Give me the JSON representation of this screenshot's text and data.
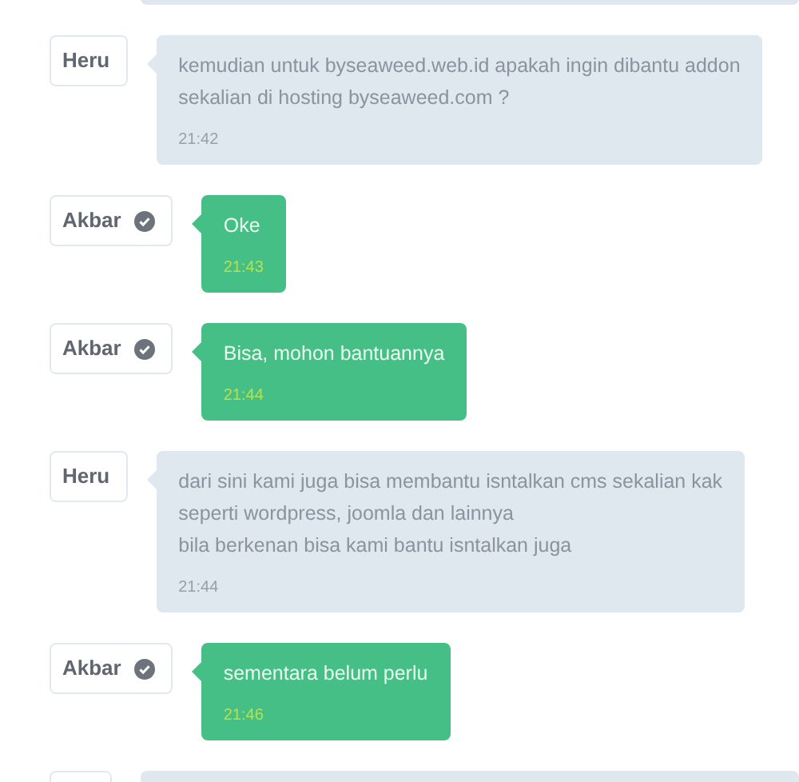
{
  "messages": [
    {
      "kind": "stub_top"
    },
    {
      "kind": "agent",
      "sender": "Heru",
      "verified": false,
      "text": "kemudian untuk byseaweed.web.id apakah ingin dibantu addon\nsekalian di hosting byseaweed.com ?",
      "time": "21:42"
    },
    {
      "kind": "customer",
      "sender": "Akbar",
      "verified": true,
      "text": "Oke",
      "time": "21:43"
    },
    {
      "kind": "customer",
      "sender": "Akbar",
      "verified": true,
      "text": "Bisa, mohon bantuannya",
      "time": "21:44"
    },
    {
      "kind": "agent",
      "sender": "Heru",
      "verified": false,
      "text": "dari sini kami juga bisa membantu isntalkan cms sekalian kak\nseperti wordpress, joomla dan lainnya\nbila berkenan bisa kami bantu isntalkan juga",
      "time": "21:44"
    },
    {
      "kind": "customer",
      "sender": "Akbar",
      "verified": true,
      "text": "sementara belum perlu",
      "time": "21:46"
    },
    {
      "kind": "stub_bottom"
    }
  ]
}
